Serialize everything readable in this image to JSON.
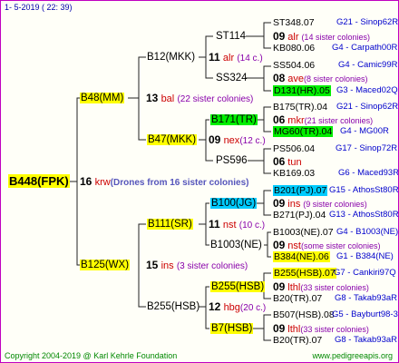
{
  "header": "1-  5-2019  ( 22: 39)",
  "footer_left": "Copyright 2004-2019 @ Karl Kehrle Foundation",
  "footer_right": "www.pedigreeapis.org",
  "root": {
    "name": "B448(FPK)",
    "num": "16",
    "race": "krw",
    "note": "(Drones from 16 sister colonies)"
  },
  "g1": [
    {
      "name": "B48(MM)",
      "num": "13",
      "race": "bal",
      "note": "(22 sister colonies)"
    },
    {
      "name": "B125(WX)",
      "num": "15",
      "race": "ins",
      "note": "(3 sister colonies)"
    }
  ],
  "g2": [
    {
      "name": "B12(MKK)",
      "num": "11",
      "race": "alr",
      "note": "(14 c.)"
    },
    {
      "name": "B47(MKK)",
      "num": "09",
      "race": "nex",
      "note": "(12 c.)"
    },
    {
      "name": "B111(SR)",
      "num": "11",
      "race": "nst",
      "note": "(10 c.)"
    },
    {
      "name": "B255(HSB)",
      "num": "12",
      "race": "hbg",
      "note": "(20 c.)"
    }
  ],
  "g3": [
    {
      "name": "ST114",
      "num": "09",
      "race": "alr",
      "note": "(14 sister colonies)"
    },
    {
      "name": "SS324",
      "num": "08",
      "race": "ave",
      "note": "(8 sister colonies)"
    },
    {
      "name": "B171(TR)",
      "num": "06",
      "race": "mkr",
      "note": "(21 sister colonies)"
    },
    {
      "name": "PS596",
      "num": "06",
      "race": "tun",
      "note": ""
    },
    {
      "name": "B100(JG)",
      "num": "09",
      "race": "ins",
      "note": "(9 sister colonies)"
    },
    {
      "name": "B1003(NE)",
      "num": "09",
      "race": "nst",
      "note": "(some sister colonies)"
    },
    {
      "name": "B255(HSB)",
      "num": "09",
      "race": "lthl",
      "note": "(33 sister colonies)"
    },
    {
      "name": "B7(HSB)",
      "num": "09",
      "race": "lthl",
      "note": "(33 sister colonies)"
    }
  ],
  "g4": [
    {
      "name": "ST348.07",
      "info": "G21 - Sinop62R"
    },
    {
      "name": "KB080.06",
      "info": "G4 - Carpath00R"
    },
    {
      "name": "SS504.06",
      "info": "G4 - Camic99R"
    },
    {
      "name": "D131(HR).05",
      "info": "G3 - Maced02Q"
    },
    {
      "name": "B175(TR).04",
      "info": "G21 - Sinop62R"
    },
    {
      "name": "MG60(TR).04",
      "info": "G4 - MG00R"
    },
    {
      "name": "PS506.04",
      "info": "G17 - Sinop72R"
    },
    {
      "name": "KB169.03",
      "info": "G6 - Maced93R"
    },
    {
      "name": "B201(PJ).07",
      "info": "G15 - AthosSt80R"
    },
    {
      "name": "B271(PJ).04",
      "info": "G13 - AthosSt80R"
    },
    {
      "name": "B1003(NE).07",
      "info": "G4 - B1003(NE)"
    },
    {
      "name": "B384(NE).06",
      "info": "G1 - B384(NE)"
    },
    {
      "name": "B255(HSB).07",
      "info": "G7 - Cankiri97Q"
    },
    {
      "name": "B20(TR).07",
      "info": "G8 - Takab93aR"
    },
    {
      "name": "B507(HSB).08",
      "info": "G5 - Bayburt98-3"
    },
    {
      "name": "B20(TR).07",
      "info": "G8 - Takab93aR"
    }
  ]
}
